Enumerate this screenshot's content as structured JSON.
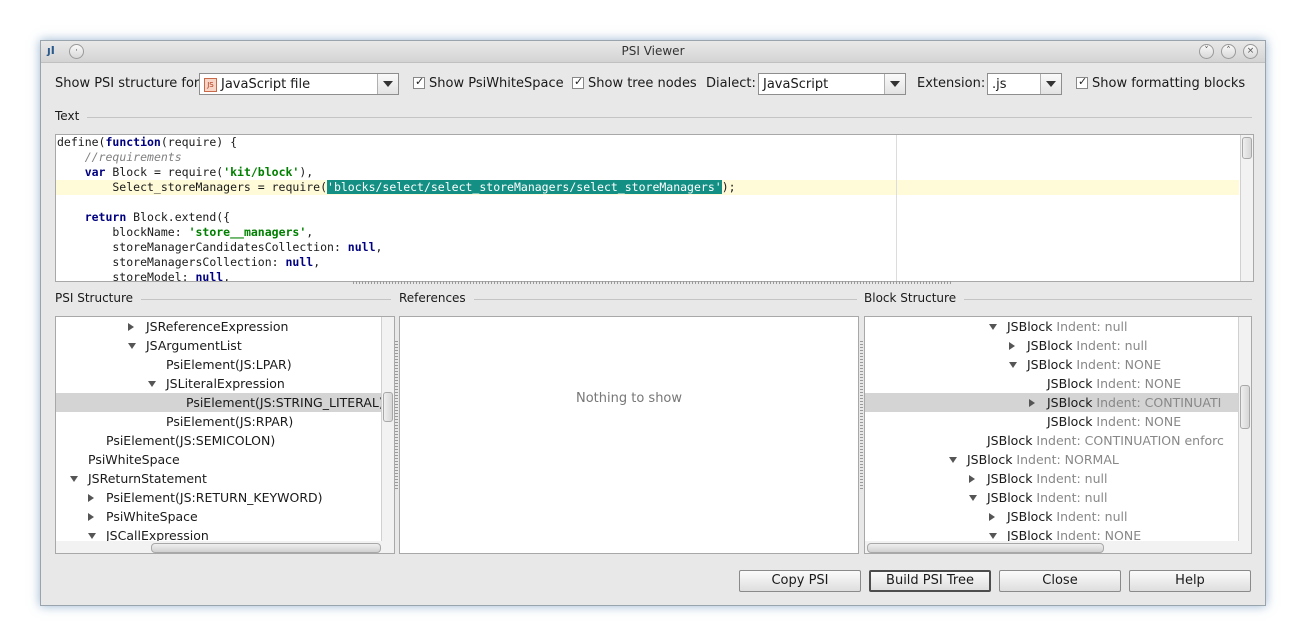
{
  "window": {
    "title": "PSI Viewer",
    "app_icon": "intellij-icon",
    "controls": [
      "minimize-icon",
      "maximize-icon",
      "close-icon"
    ]
  },
  "toolbar": {
    "show_psi_label": "Show PSI structure for:",
    "file_type_value": "JavaScript file",
    "file_type_icon": "javascript-file-icon",
    "show_whitespace_label": "Show PsiWhiteSpace",
    "show_whitespace_checked": true,
    "show_tree_nodes_label": "Show tree nodes",
    "show_tree_nodes_checked": true,
    "dialect_label": "Dialect:",
    "dialect_value": "JavaScript",
    "extension_label": "Extension:",
    "extension_value": ".js",
    "show_formatting_label": "Show formatting blocks",
    "show_formatting_checked": true
  },
  "text_section": {
    "title": "Text",
    "lines": [
      "define(function(require) {",
      "    //requirements",
      "    var Block = require('kit/block'),",
      "        Select_storeManagers = require('blocks/select/select_storeManagers/select_storeManagers');",
      "",
      "    return Block.extend({",
      "        blockName: 'store__managers',",
      "        storeManagerCandidatesCollection: null,",
      "        storeManagersCollection: null,",
      "        storeModel: null,"
    ],
    "highlighted_line_index": 3,
    "selected_text": "'blocks/select/select_storeManagers/select_storeManagers'"
  },
  "psi_structure": {
    "title": "PSI Structure",
    "rows": [
      {
        "text": "JSReferenceExpression",
        "expander": "collapsed",
        "selected": false
      },
      {
        "text": "JSArgumentList",
        "expander": "expanded",
        "selected": false
      },
      {
        "text": "PsiElement(JS:LPAR)",
        "expander": "none",
        "selected": false
      },
      {
        "text": "JSLiteralExpression",
        "expander": "expanded",
        "selected": false
      },
      {
        "text": "PsiElement(JS:STRING_LITERAL)",
        "expander": "none",
        "selected": true
      },
      {
        "text": "PsiElement(JS:RPAR)",
        "expander": "none",
        "selected": false
      },
      {
        "text": "PsiElement(JS:SEMICOLON)",
        "expander": "none",
        "selected": false
      },
      {
        "text": "PsiWhiteSpace",
        "expander": "none",
        "selected": false
      },
      {
        "text": "JSReturnStatement",
        "expander": "expanded",
        "selected": false
      },
      {
        "text": "PsiElement(JS:RETURN_KEYWORD)",
        "expander": "collapsed",
        "selected": false
      },
      {
        "text": "PsiWhiteSpace",
        "expander": "collapsed",
        "selected": false
      },
      {
        "text": "JSCallExpression",
        "expander": "expanded",
        "selected": false
      }
    ]
  },
  "references": {
    "title": "References",
    "empty_text": "Nothing to show"
  },
  "block_structure": {
    "title": "Block Structure",
    "rows": [
      {
        "name": "JSBlock",
        "detail": "Indent: null",
        "expander": "expanded",
        "selected": false
      },
      {
        "name": "JSBlock",
        "detail": "Indent: null",
        "expander": "collapsed",
        "selected": false
      },
      {
        "name": "JSBlock",
        "detail": "Indent: NONE",
        "expander": "expanded",
        "selected": false
      },
      {
        "name": "JSBlock",
        "detail": "Indent: NONE",
        "expander": "none",
        "selected": false
      },
      {
        "name": "JSBlock",
        "detail": "Indent: CONTINUATI",
        "expander": "collapsed",
        "selected": true
      },
      {
        "name": "JSBlock",
        "detail": "Indent: NONE",
        "expander": "none",
        "selected": false
      },
      {
        "name": "JSBlock",
        "detail": "Indent: CONTINUATION enforc",
        "expander": "none",
        "selected": false
      },
      {
        "name": "JSBlock",
        "detail": "Indent: NORMAL",
        "expander": "expanded",
        "selected": false
      },
      {
        "name": "JSBlock",
        "detail": "Indent: null",
        "expander": "collapsed",
        "selected": false
      },
      {
        "name": "JSBlock",
        "detail": "Indent: null",
        "expander": "expanded",
        "selected": false
      },
      {
        "name": "JSBlock",
        "detail": "Indent: null",
        "expander": "collapsed",
        "selected": false
      },
      {
        "name": "JSBlock",
        "detail": "Indent: NONE",
        "expander": "expanded",
        "selected": false
      }
    ]
  },
  "buttons": {
    "copy_psi": "Copy PSI",
    "build_psi_tree": "Build PSI Tree",
    "close": "Close",
    "help": "Help"
  },
  "colors": {
    "selection": "#148f84",
    "keyword": "#000080",
    "string": "#008000",
    "comment": "#808080",
    "highlight_line": "#fffbd8"
  }
}
